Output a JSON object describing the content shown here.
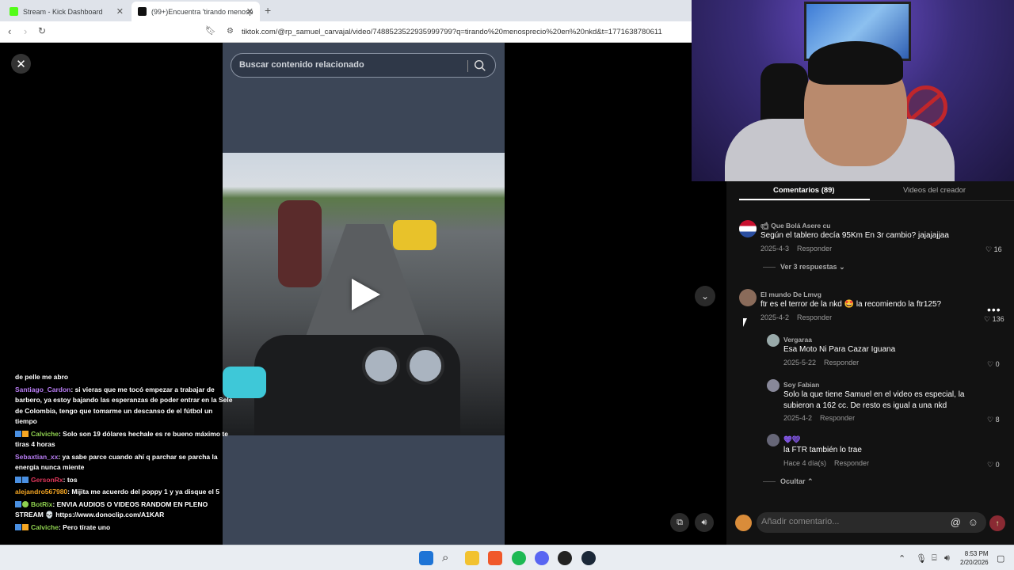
{
  "browser": {
    "tabs": [
      {
        "title": "Stream - Kick Dashboard",
        "active": false
      },
      {
        "title": "(99+)Encuentra 'tirando menosp",
        "active": true
      }
    ],
    "url": "tiktok.com/@rp_samuel_carvajal/video/7488523522935999799?q=tirando%20menosprecio%20en%20nkd&t=1771638780611"
  },
  "video": {
    "search_placeholder": "Buscar contenido relacionado"
  },
  "chat": [
    {
      "user": "",
      "text": "de pelle me abro",
      "user_color": "#ffffff"
    },
    {
      "user": "Santiago_Cardon",
      "text": ": si vieras que me tocó empezar a trabajar de barbero, ya estoy bajando las esperanzas de poder entrar en la Sele de Colombia, tengo que tomarme un descanso de el fútbol un tiempo",
      "user_color": "#b77cf2"
    },
    {
      "user": "Calviche",
      "text": ": Solo son 19 dólares hechale es re bueno máximo te tiras 4 horas",
      "user_color": "#8fd14f"
    },
    {
      "user": "Sebaxtian_xx",
      "text": ": ya sabe parce cuando ahí q parchar se parcha la energía nunca miente",
      "user_color": "#b77cf2"
    },
    {
      "user": "GersonRx",
      "text": ": tos",
      "user_color": "#e0365a"
    },
    {
      "user": "alejandro567980",
      "text": ": Mijita me acuerdo del poppy 1 y ya disque el 5",
      "user_color": "#f5a623"
    },
    {
      "user": "BotRix",
      "text": ": ENVIA AUDIOS O VIDEOS RANDOM EN PLENO STREAM 💀 https://www.donoclip.com/A1KAR",
      "user_color": "#8fd14f"
    },
    {
      "user": "Calviche",
      "text": ": Pero tírate uno",
      "user_color": "#8fd14f"
    }
  ],
  "comments_panel": {
    "tab_comments": "Comentarios (89)",
    "tab_creator": "Videos del creador",
    "comments": [
      {
        "user": "Que Bolá Asere cu",
        "text": "Según el tablero decía 95Km En 3r cambio? jajajajjaa",
        "date": "2025-4-3",
        "reply": "Responder",
        "likes": "16",
        "view_replies": "Ver 3 respuestas"
      },
      {
        "user": "El mundo De Lmvg",
        "text": "ftr es el terror de la nkd 🤩 la recomiendo la ftr125?",
        "date": "2025-4-2",
        "reply": "Responder",
        "likes": "136"
      }
    ],
    "replies": [
      {
        "user": "Vergaraa",
        "text": "Esa Moto Ni Para Cazar Iguana",
        "date": "2025-5-22",
        "reply": "Responder",
        "likes": "0"
      },
      {
        "user": "Soy Fabian",
        "text": "Solo la que tiene Samuel en el video es especial, la subieron a 162 cc. De resto es igual a una nkd",
        "date": "2025-4-2",
        "reply": "Responder",
        "likes": "8"
      },
      {
        "user": "",
        "text": "la FTR también lo trae",
        "date": "Hace 4 día(s)",
        "reply": "Responder",
        "likes": "0"
      }
    ],
    "hide_label": "Ocultar",
    "input_placeholder": "Añadir comentario..."
  },
  "taskbar": {
    "time": "8:53 PM",
    "date": "2/20/2026"
  },
  "colors": {
    "video_panel_bg": "#3c4657",
    "comments_bg": "#121212",
    "send_button": "#8a2a33"
  }
}
